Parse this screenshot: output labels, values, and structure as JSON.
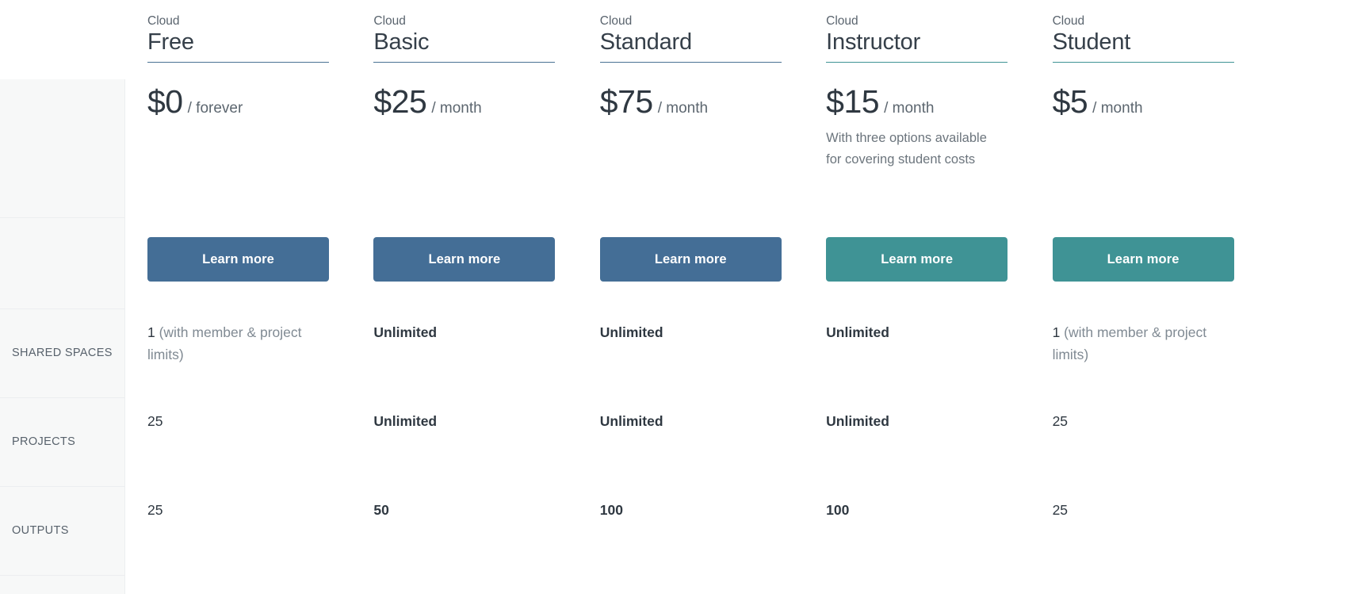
{
  "colors": {
    "primary_blue": "#446e96",
    "accent_teal": "#3f9395",
    "rule_blue": "#4a7294",
    "rule_teal": "#3f9395",
    "rail_background": "#f7f8f8",
    "text_dark": "#2f3841",
    "text_muted": "#808a93"
  },
  "features": {
    "rows": [
      {
        "label": "SHARED SPACES"
      },
      {
        "label": "PROJECTS"
      },
      {
        "label": "OUTPUTS"
      }
    ]
  },
  "plans": [
    {
      "kicker": "Cloud",
      "name": "Free",
      "rule_color": "#4a7294",
      "price_amount": "$0",
      "price_period": "/ forever",
      "price_note": "",
      "cta_label": "Learn more",
      "cta_color": "#446e96",
      "values": [
        {
          "lead": "1",
          "note": " (with member & project limits)",
          "bold": false
        },
        {
          "lead": "25",
          "note": "",
          "bold": false
        },
        {
          "lead": "25",
          "note": "",
          "bold": false
        }
      ]
    },
    {
      "kicker": "Cloud",
      "name": "Basic",
      "rule_color": "#4a7294",
      "price_amount": "$25",
      "price_period": "/ month",
      "price_note": "",
      "cta_label": "Learn more",
      "cta_color": "#446e96",
      "values": [
        {
          "lead": "Unlimited",
          "note": "",
          "bold": true
        },
        {
          "lead": "Unlimited",
          "note": "",
          "bold": true
        },
        {
          "lead": "50",
          "note": "",
          "bold": true
        }
      ]
    },
    {
      "kicker": "Cloud",
      "name": "Standard",
      "rule_color": "#4a7294",
      "price_amount": "$75",
      "price_period": "/ month",
      "price_note": "",
      "cta_label": "Learn more",
      "cta_color": "#446e96",
      "values": [
        {
          "lead": "Unlimited",
          "note": "",
          "bold": true
        },
        {
          "lead": "Unlimited",
          "note": "",
          "bold": true
        },
        {
          "lead": "100",
          "note": "",
          "bold": true
        }
      ]
    },
    {
      "kicker": "Cloud",
      "name": "Instructor",
      "rule_color": "#3f9395",
      "price_amount": "$15",
      "price_period": "/ month",
      "price_note": "With three options available for covering student costs",
      "cta_label": "Learn more",
      "cta_color": "#3f9395",
      "values": [
        {
          "lead": "Unlimited",
          "note": "",
          "bold": true
        },
        {
          "lead": "Unlimited",
          "note": "",
          "bold": true
        },
        {
          "lead": "100",
          "note": "",
          "bold": true
        }
      ]
    },
    {
      "kicker": "Cloud",
      "name": "Student",
      "rule_color": "#3f9395",
      "price_amount": "$5",
      "price_period": "/ month",
      "price_note": "",
      "cta_label": "Learn more",
      "cta_color": "#3f9395",
      "values": [
        {
          "lead": "1",
          "note": " (with member & project limits)",
          "bold": false
        },
        {
          "lead": "25",
          "note": "",
          "bold": false
        },
        {
          "lead": "25",
          "note": "",
          "bold": false
        }
      ]
    }
  ]
}
